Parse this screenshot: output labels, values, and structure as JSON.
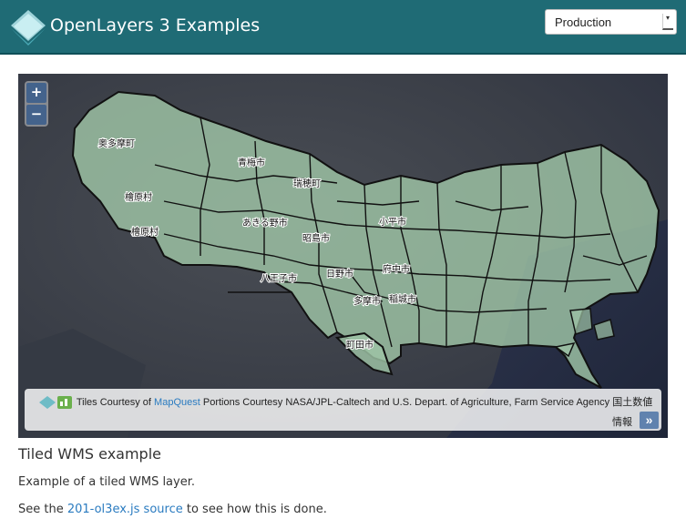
{
  "header": {
    "brand": "OpenLayers 3 Examples",
    "mode_select_value": "Production"
  },
  "map": {
    "zoom_in_label": "+",
    "zoom_out_label": "−",
    "attribution_tiles_prefix": "Tiles Courtesy of",
    "attribution_tiles_link": "MapQuest",
    "attribution_rest": "Portions Courtesy NASA/JPL-Caltech and U.S. Depart. of Agriculture, Farm Service Agency 国土数値",
    "attribution_line2": "情報",
    "attribution_toggle": "»",
    "place_labels": {
      "okutama": "奥多摩町",
      "ome": "青梅市",
      "mizuho": "瑞穂町",
      "hinohara1": "檜原村",
      "hinohara2": "檜原村",
      "akiruno": "あきる野市",
      "akishima": "昭島市",
      "kodaira": "小平市",
      "hachioji": "八王子市",
      "hino": "日野市",
      "fuchu": "府中市",
      "tama": "多摩市",
      "inagi": "稲城市",
      "machida": "町田市"
    }
  },
  "content": {
    "title": "Tiled WMS example",
    "short_desc": "Example of a tiled WMS layer.",
    "source_prefix": "See the",
    "source_link": "201-ol3ex.js source",
    "source_suffix": "to see how this is done."
  }
}
